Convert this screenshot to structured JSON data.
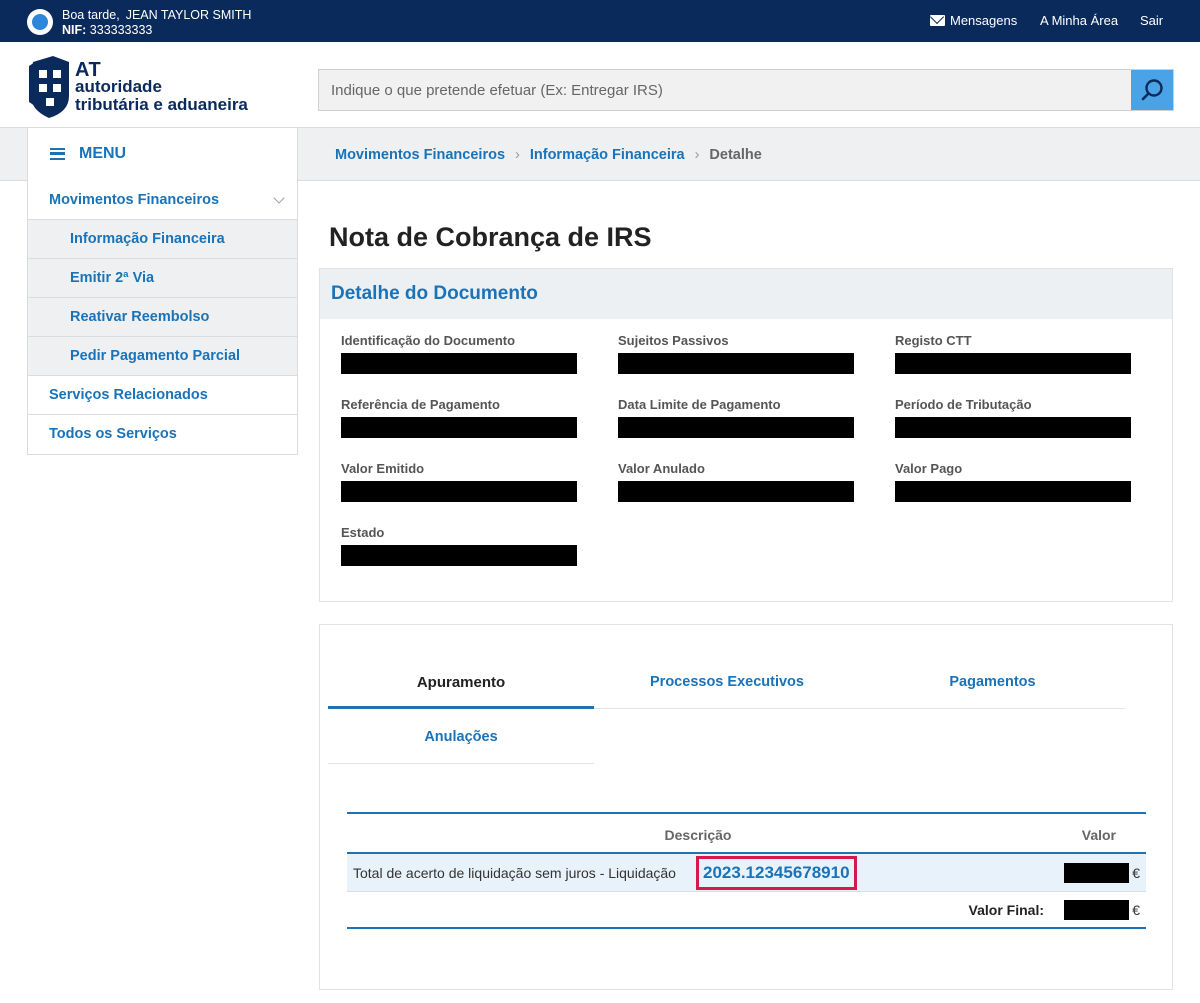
{
  "topbar": {
    "greeting": "Boa tarde,",
    "user_name": "JEAN TAYLOR SMITH",
    "nif_label": "NIF:",
    "nif_value": "333333333",
    "links": [
      {
        "label": "Mensagens",
        "icon": "envelope-icon"
      },
      {
        "label": "A Minha Área"
      },
      {
        "label": "Sair"
      }
    ]
  },
  "logo": {
    "abbr": "AT",
    "line1": "autoridade",
    "line2": "tributária e aduaneira",
    "colors": {
      "primary": "#0b2a5c"
    }
  },
  "search": {
    "placeholder": "Indique o que pretende efetuar (Ex: Entregar IRS)",
    "value": "",
    "icon": "search-icon"
  },
  "menu": {
    "label": "MENU",
    "icon": "hamburger-icon"
  },
  "breadcrumb": {
    "items": [
      "Movimentos Financeiros",
      "Informação Financeira"
    ],
    "current": "Detalhe"
  },
  "sidebar": {
    "items": [
      {
        "label": "Movimentos Financeiros",
        "expanded": true
      },
      {
        "label": "Informação Financeira"
      },
      {
        "label": "Emitir 2ª Via"
      },
      {
        "label": "Reativar Reembolso"
      },
      {
        "label": "Pedir Pagamento Parcial"
      },
      {
        "label": "Serviços Relacionados"
      },
      {
        "label": "Todos os Serviços"
      }
    ]
  },
  "page": {
    "title": "Nota de Cobrança de IRS"
  },
  "detail": {
    "heading": "Detalhe do Documento",
    "fields": [
      {
        "label": "Identificação do Documento",
        "redacted": true
      },
      {
        "label": "Sujeitos Passivos",
        "redacted": true
      },
      {
        "label": "Registo CTT",
        "redacted": true
      },
      {
        "label": "Referência de Pagamento",
        "redacted": true
      },
      {
        "label": "Data Limite de Pagamento",
        "redacted": true
      },
      {
        "label": "Período de Tributação",
        "redacted": true
      },
      {
        "label": "Valor Emitido",
        "redacted": true
      },
      {
        "label": "Valor Anulado",
        "redacted": true
      },
      {
        "label": "Valor Pago",
        "redacted": true
      },
      {
        "label": "Estado",
        "redacted": true
      }
    ]
  },
  "tabs": {
    "items": [
      {
        "label": "Apuramento",
        "active": true
      },
      {
        "label": "Processos Executivos"
      },
      {
        "label": "Pagamentos"
      },
      {
        "label": "Anulações"
      }
    ]
  },
  "table": {
    "columns": [
      "Descrição",
      "Valor"
    ],
    "row": {
      "description": "Total de acerto de liquidação sem juros - Liquidação",
      "link": "2023.12345678910",
      "currency": "€",
      "value_redacted": true
    },
    "final": {
      "label": "Valor Final:",
      "currency": "€",
      "value_redacted": true
    }
  },
  "colors": {
    "topbar": "#0b2a5c",
    "link": "#1a73b8",
    "highlight_border": "#d6194a",
    "search_button": "#4aa3e6"
  }
}
